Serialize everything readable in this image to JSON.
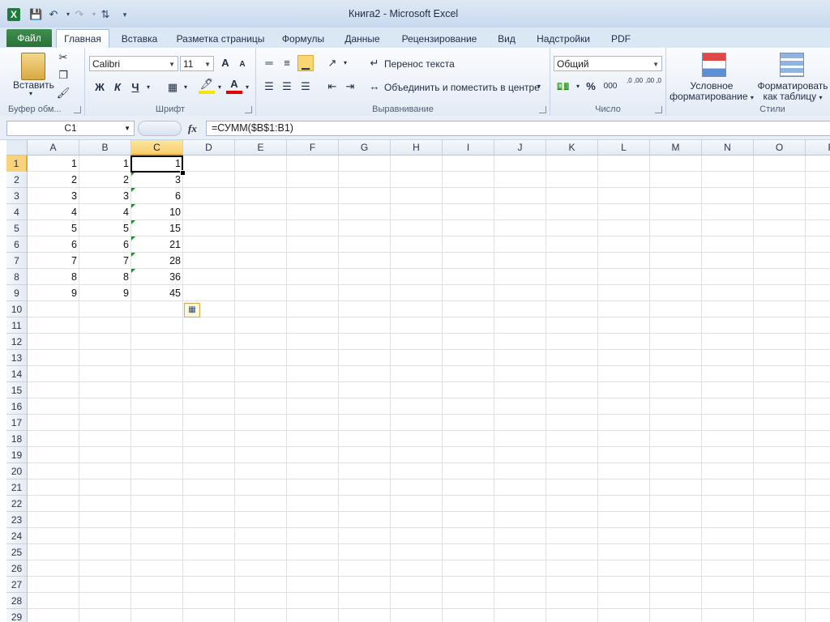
{
  "window": {
    "title": "Книга2  -  Microsoft Excel"
  },
  "quick_access": {
    "app_icon": "X"
  },
  "tabs": [
    "Файл",
    "Главная",
    "Вставка",
    "Разметка страницы",
    "Формулы",
    "Данные",
    "Рецензирование",
    "Вид",
    "Надстройки",
    "PDF"
  ],
  "ribbon": {
    "clipboard": {
      "paste_label": "Вставить",
      "group_label": "Буфер обм..."
    },
    "font": {
      "font_name": "Calibri",
      "font_size": "11",
      "bold": "Ж",
      "italic": "К",
      "underline": "Ч",
      "grow": "A",
      "shrink": "A",
      "group_label": "Шрифт"
    },
    "alignment": {
      "wrap_text": "Перенос текста",
      "merge_center": "Объединить и поместить в центре",
      "group_label": "Выравнивание"
    },
    "number": {
      "format": "Общий",
      "percent": "%",
      "thousands": "000",
      "inc_decimal": ",0 ,00",
      "dec_decimal": ",00 ,0",
      "group_label": "Число"
    },
    "styles": {
      "conditional_line1": "Условное",
      "conditional_line2": "форматирование",
      "format_table_line1": "Форматировать",
      "format_table_line2": "как таблицу",
      "group_label": "Стили"
    }
  },
  "formula_bar": {
    "name_box": "C1",
    "fx": "fx",
    "formula": "=СУММ($B$1:B1)"
  },
  "sheet": {
    "columns": [
      "A",
      "B",
      "C",
      "D",
      "E",
      "F",
      "G",
      "H",
      "I",
      "J",
      "K",
      "L",
      "M",
      "N",
      "O",
      "P"
    ],
    "selected_column": "C",
    "selected_row": 1,
    "rows": 29,
    "data": [
      [
        "1",
        "1",
        "1"
      ],
      [
        "2",
        "2",
        "3"
      ],
      [
        "3",
        "3",
        "6"
      ],
      [
        "4",
        "4",
        "10"
      ],
      [
        "5",
        "5",
        "15"
      ],
      [
        "6",
        "6",
        "21"
      ],
      [
        "7",
        "7",
        "28"
      ],
      [
        "8",
        "8",
        "36"
      ],
      [
        "9",
        "9",
        "45"
      ]
    ],
    "error_indicator_rows": [
      2,
      3,
      4,
      5,
      6,
      7,
      8
    ]
  },
  "colors": {
    "accent": "#2a7139",
    "selection": "#f8d27c",
    "grid": "#dbe1e9"
  }
}
